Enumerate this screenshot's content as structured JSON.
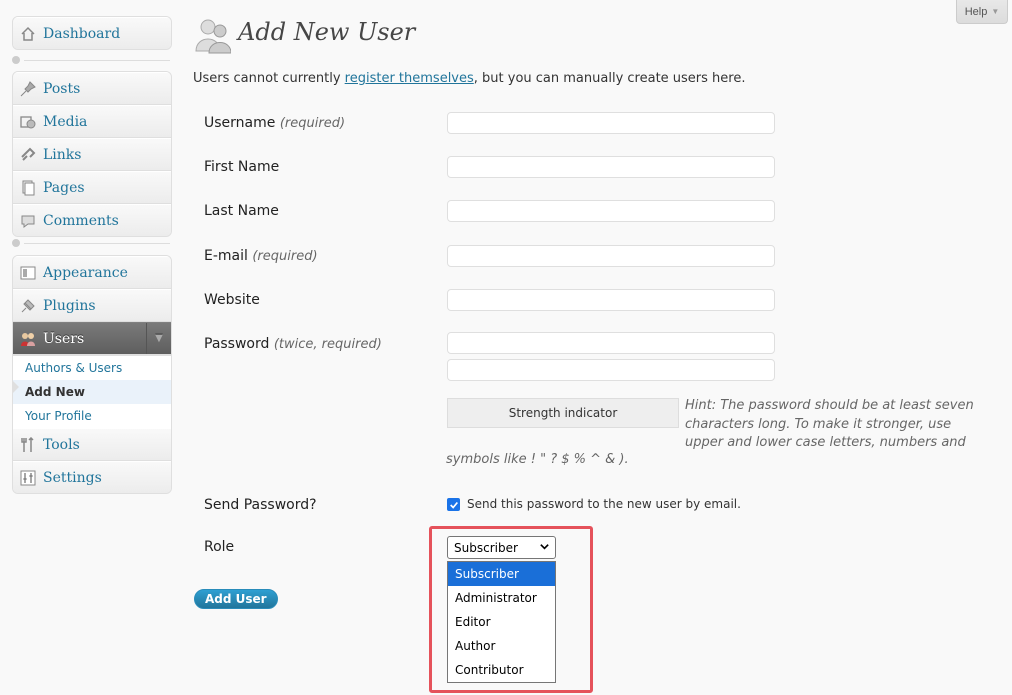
{
  "sidebar": {
    "dashboard": "Dashboard",
    "posts": "Posts",
    "media": "Media",
    "links": "Links",
    "pages": "Pages",
    "comments": "Comments",
    "appearance": "Appearance",
    "plugins": "Plugins",
    "users": "Users",
    "users_submenu": [
      "Authors & Users",
      "Add New",
      "Your Profile"
    ],
    "tools": "Tools",
    "settings": "Settings"
  },
  "help": {
    "label": "Help"
  },
  "page": {
    "title": "Add New User",
    "intro_before": "Users cannot currently ",
    "intro_link": "register themselves",
    "intro_after": ", but you can manually create users here."
  },
  "form": {
    "username_label": "Username",
    "username_note": "(required)",
    "first_name_label": "First Name",
    "last_name_label": "Last Name",
    "email_label": "E-mail",
    "email_note": "(required)",
    "website_label": "Website",
    "password_label": "Password",
    "password_note": "(twice, required)",
    "strength_indicator": "Strength indicator",
    "hint_part1": "Hint: The password should be at least seven characters long. To make it stronger, use upper and lower case letters, numbers and",
    "hint_part2": "symbols like ! \" ? $ % ^ & ).",
    "send_password_label": "Send Password?",
    "send_password_text": "Send this password to the new user by email.",
    "send_password_checked": true,
    "role_label": "Role",
    "role_selected": "Subscriber",
    "role_options": [
      "Subscriber",
      "Administrator",
      "Editor",
      "Author",
      "Contributor"
    ],
    "submit_label": "Add User"
  },
  "colors": {
    "link": "#21759b",
    "selected_option": "#1a6fd8",
    "highlight": "#e5525b"
  }
}
